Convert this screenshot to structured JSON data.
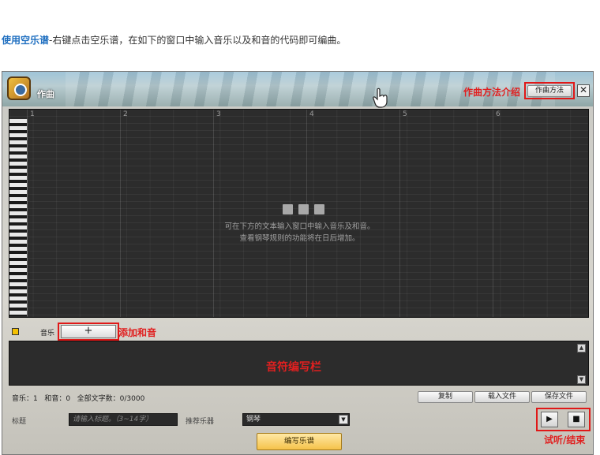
{
  "intro": {
    "highlight": "使用空乐谱",
    "text": "-右键点击空乐谱，在如下的窗口中输入音乐以及和音的代码即可编曲。"
  },
  "window": {
    "title": "作曲",
    "close_label": "✕"
  },
  "annotations": {
    "guide": "作曲方法介绍",
    "add_harmony": "添加和音",
    "editor": "音符编写栏",
    "play_stop": "试听/结束"
  },
  "toolbar": {
    "guide_button": "作曲方法"
  },
  "grid": {
    "measures": [
      "1",
      "2",
      "3",
      "4",
      "5",
      "6"
    ],
    "message_line1": "可在下方的文本输入窗口中输入音乐及和音。",
    "message_line2": "查看钢琴规则的功能将在日后增加。"
  },
  "tabs": {
    "music_label": "音乐",
    "add_label": "+"
  },
  "status": {
    "music": "音乐：1",
    "harmony": "和音：0",
    "chars": "全部文字数：0/3000"
  },
  "actions": {
    "copy": "复制",
    "load": "载入文件",
    "save": "保存文件"
  },
  "form": {
    "title_label": "标题",
    "title_placeholder": "请输入标题。（3~14字）",
    "instrument_label": "推荐乐器",
    "instrument_value": "钢琴"
  },
  "controls": {
    "play": "▶",
    "stop": "■"
  },
  "compose_button": "编写乐谱",
  "colors": {
    "accent_red": "#e01818",
    "highlight_blue": "#1f6fc0",
    "compose_yellow": "#f5c24a"
  },
  "icons": {
    "app": "music-box-icon",
    "cursor": "hand-cursor-icon",
    "close": "close-icon",
    "dropdown": "chevron-down-icon"
  }
}
